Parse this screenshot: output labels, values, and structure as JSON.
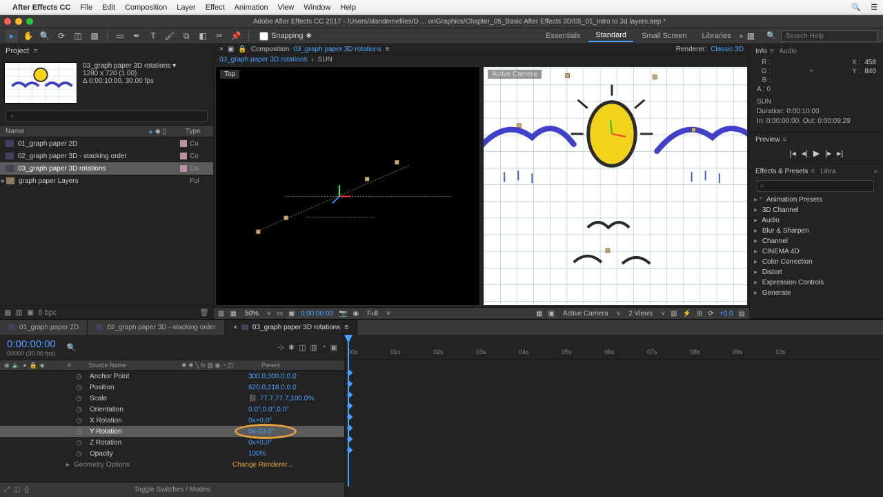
{
  "menubar": {
    "app": "After Effects CC",
    "items": [
      "File",
      "Edit",
      "Composition",
      "Layer",
      "Effect",
      "Animation",
      "View",
      "Window",
      "Help"
    ]
  },
  "titlebar": {
    "title": "Adobe After Effects CC 2017 - /Users/alandemefiles/D ... onGraphics/Chapter_05_Basic After Effects 3D/05_01_intro to 3d layers.aep *"
  },
  "toolbar": {
    "snapping_label": "Snapping",
    "workspaces": [
      "Essentials",
      "Standard",
      "Small Screen",
      "Libraries"
    ],
    "active_workspace": 1,
    "search_placeholder": "Search Help"
  },
  "project": {
    "tab": "Project",
    "selected_name": "03_graph paper 3D rotations ▾",
    "dims": "1280 x 720 (1.00)",
    "dur": "Δ 0:00:10:00, 30.00 fps",
    "search_placeholder": "⌕",
    "cols": {
      "name": "Name",
      "type": "Type"
    },
    "rows": [
      {
        "name": "01_graph paper 2D",
        "kind": "comp",
        "label": "#b98fa8",
        "type": "Co"
      },
      {
        "name": "02_graph paper 3D - stacking order",
        "kind": "comp",
        "label": "#b98fa8",
        "type": "Co"
      },
      {
        "name": "03_graph paper 3D rotations",
        "kind": "comp",
        "label": "#b98fa8",
        "type": "Co",
        "selected": true
      },
      {
        "name": "graph paper Layers",
        "kind": "folder",
        "label": "",
        "type": "Fol",
        "expandable": true
      }
    ],
    "footer_bpc": "8 bpc"
  },
  "comp": {
    "tabs_label": "Composition",
    "comp_name": "03_graph paper 3D rotations",
    "renderer_label": "Renderer:",
    "renderer_value": "Classic 3D",
    "breadcrumb": [
      "03_graph paper 3D rotations",
      "SUN"
    ],
    "view_labels": {
      "left": "Top",
      "right": "Active Camera"
    },
    "footer": {
      "mag": "50%",
      "timecode": "0:00:00:00",
      "res": "Full",
      "view_mode": "Active Camera",
      "views": "2 Views",
      "exposure": "+0.0"
    }
  },
  "right": {
    "info_tab": "Info",
    "audio_tab": "Audio",
    "rgb": {
      "r": "R :",
      "g": "G :",
      "b": "B :",
      "a": "A :  0"
    },
    "xy": {
      "x_label": "X :",
      "x_val": "458",
      "y_label": "Y :",
      "y_val": "840"
    },
    "solo": {
      "layer": "SUN",
      "duration": "Duration: 0:00:10:00",
      "inout": "In: 0:00:00:00, Out: 0:00:09:29"
    },
    "preview_tab": "Preview",
    "effects_tab": "Effects & Presets",
    "libra_tab": "Libra",
    "search_placeholder": "⌕",
    "tree": [
      "Animation Presets",
      "3D Channel",
      "Audio",
      "Blur & Sharpen",
      "Channel",
      "CINEMA 4D",
      "Color Correction",
      "Distort",
      "Expression Controls",
      "Generate"
    ]
  },
  "timeline": {
    "tabs": [
      {
        "label": "01_graph paper 2D"
      },
      {
        "label": "02_graph paper 3D - stacking order"
      },
      {
        "label": "03_graph paper 3D rotations",
        "active": true
      }
    ],
    "timecode": "0:00:00:00",
    "fps": "00000 (30.00 fps)",
    "cols": {
      "source": "Source Name",
      "parent": "Parent"
    },
    "props": [
      {
        "name": "Anchor Point",
        "value": "300.0,300.0,0.0"
      },
      {
        "name": "Position",
        "value": "620.0,218.0,0.0"
      },
      {
        "name": "Scale",
        "value": "77.7,77.7,100.0%",
        "chain": true
      },
      {
        "name": "Orientation",
        "value": "0.0°,0.0°,0.0°"
      },
      {
        "name": "X Rotation",
        "value": "0x+0.0°"
      },
      {
        "name": "Y Rotation",
        "value": "0x-33.0°",
        "selected": true,
        "highlight": true
      },
      {
        "name": "Z Rotation",
        "value": "0x+0.0°"
      },
      {
        "name": "Opacity",
        "value": "100%"
      },
      {
        "name": "Geometry Options",
        "value": "Change Renderer...",
        "change": true
      }
    ],
    "footer": "Toggle Switches / Modes",
    "ruler": [
      "00s",
      "01s",
      "02s",
      "03s",
      "04s",
      "05s",
      "06s",
      "07s",
      "08s",
      "09s",
      "10s"
    ]
  }
}
